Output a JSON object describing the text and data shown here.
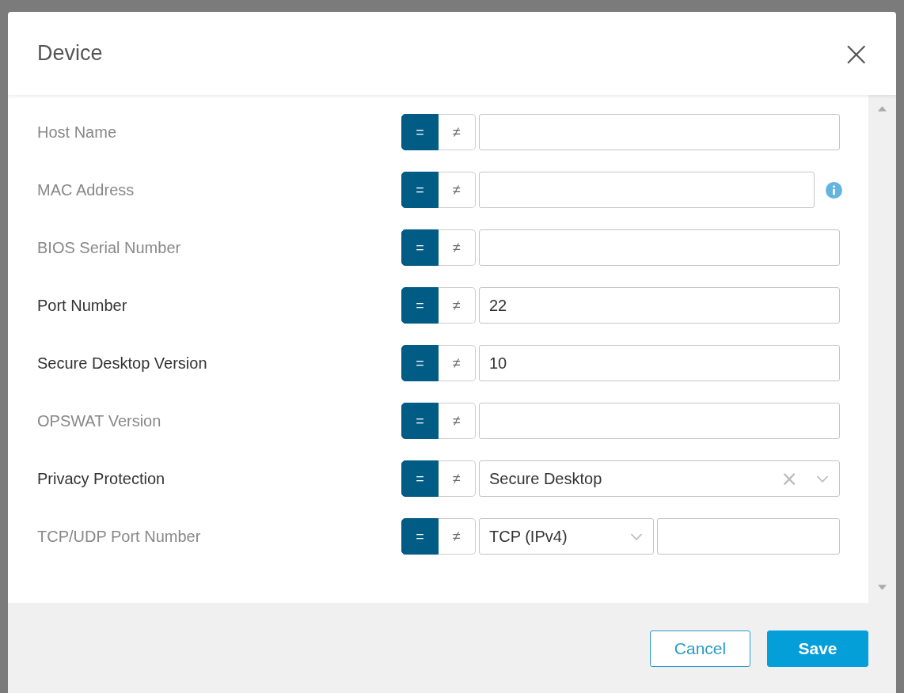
{
  "dialog": {
    "title": "Device",
    "close": "×"
  },
  "fields": [
    {
      "label": "Host Name",
      "in_use": false,
      "kind": "text",
      "operators": [
        {
          "symbol": "=",
          "selected": true
        },
        {
          "symbol": "≠",
          "selected": false
        }
      ],
      "info": false
    },
    {
      "label": "MAC Address",
      "in_use": false,
      "kind": "text",
      "operators": [
        {
          "symbol": "=",
          "selected": true
        },
        {
          "symbol": "≠",
          "selected": false
        }
      ],
      "info": true
    },
    {
      "label": "BIOS Serial Number",
      "in_use": false,
      "kind": "text",
      "operators": [
        {
          "symbol": "=",
          "selected": true
        },
        {
          "symbol": "≠",
          "selected": false
        }
      ],
      "info": false
    },
    {
      "label": "Port Number",
      "in_use": true,
      "kind": "text",
      "value": "22",
      "operators": [
        {
          "symbol": "=",
          "selected": true
        },
        {
          "symbol": "≠",
          "selected": false
        }
      ],
      "info": false
    },
    {
      "label": "Secure Desktop Version",
      "in_use": true,
      "kind": "text",
      "value": "10",
      "operators": [
        {
          "symbol": "=",
          "selected": true
        },
        {
          "symbol": "≠",
          "selected": false
        }
      ],
      "info": false
    },
    {
      "label": "OPSWAT Version",
      "in_use": false,
      "kind": "text",
      "operators": [
        {
          "symbol": "=",
          "selected": true
        },
        {
          "symbol": "≠",
          "selected": false
        }
      ],
      "info": false
    },
    {
      "label": "Privacy Protection",
      "in_use": true,
      "kind": "select",
      "value": "Secure Desktop",
      "clear": "×",
      "operators": [
        {
          "symbol": "=",
          "selected": true
        },
        {
          "symbol": "≠",
          "selected": false
        }
      ],
      "info": false
    },
    {
      "label": "TCP/UDP Port Number",
      "in_use": false,
      "kind": "protocol",
      "value": "TCP (IPv4)",
      "operators": [
        {
          "symbol": "=",
          "selected": true
        },
        {
          "symbol": "≠",
          "selected": false
        }
      ],
      "info": false
    }
  ],
  "buttons": [
    {
      "label": "Cancel",
      "kind": "secondary"
    },
    {
      "label": "Save",
      "kind": "primary"
    }
  ]
}
